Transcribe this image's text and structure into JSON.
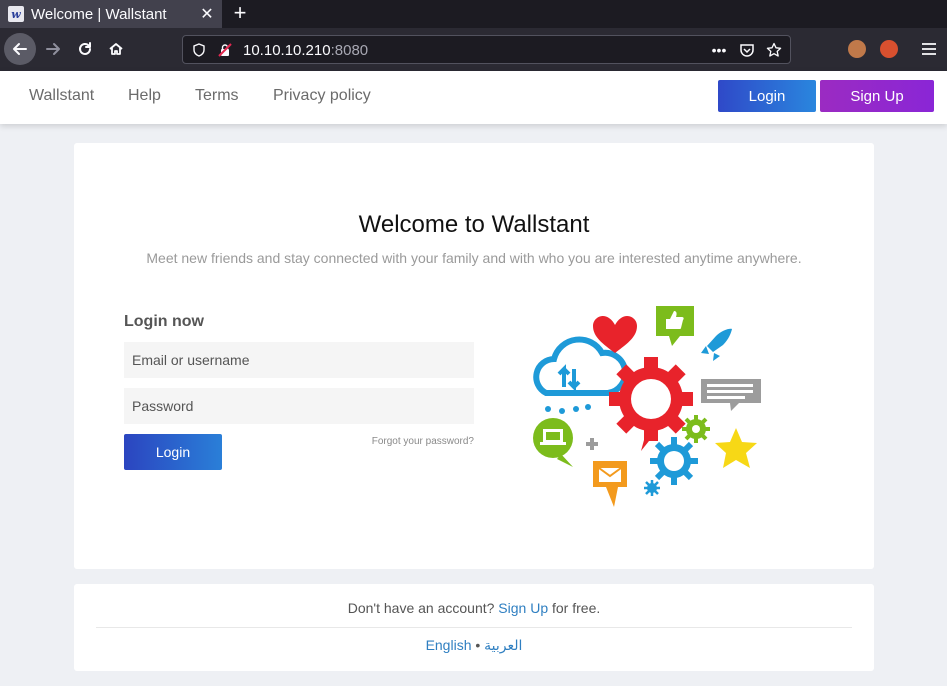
{
  "browser": {
    "tab_title": "Welcome | Wallstant",
    "favicon_letter": "w",
    "url_host": "10.10.10.210",
    "url_port": ":8080"
  },
  "header": {
    "nav": [
      "Wallstant",
      "Help",
      "Terms",
      "Privacy policy"
    ],
    "login_label": "Login",
    "signup_label": "Sign Up"
  },
  "main": {
    "title": "Welcome to Wallstant",
    "tagline": "Meet new friends and stay connected with your family and with who you are interested anytime anywhere.",
    "login_heading": "Login now",
    "username_placeholder": "Email or username",
    "password_placeholder": "Password",
    "login_button": "Login",
    "forgot_password": "Forgot your password?"
  },
  "footer": {
    "no_account": "Don't have an account?",
    "signup_link": "Sign Up",
    "for_free": "for free.",
    "lang_english": "English",
    "lang_separator": "•",
    "lang_arabic": "العربية"
  },
  "colors": {
    "primary_gradient_start": "#2b45c0",
    "primary_gradient_end": "#2a7fd8",
    "signup_gradient_start": "#9b2bc2",
    "link": "#2f7fc1"
  }
}
